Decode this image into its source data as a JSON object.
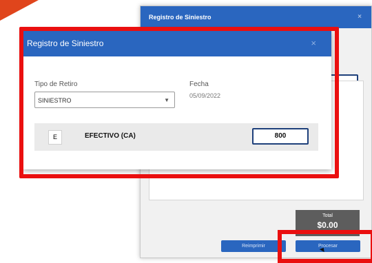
{
  "background_modal": {
    "title": "Registro de Siniestro",
    "close_glyph": "×",
    "total": {
      "label": "Total",
      "value": "$0.00"
    },
    "buttons": {
      "reimprimir": "Reimprimir",
      "procesar": "Procesar"
    }
  },
  "dialog": {
    "title": "Registro de Siniestro",
    "close_glyph": "×",
    "tipo_retiro": {
      "label": "Tipo de Retiro",
      "value": "SINIESTRO",
      "arrow": "▼"
    },
    "fecha": {
      "label": "Fecha",
      "value": "05/09/2022"
    },
    "row": {
      "code": "E",
      "label": "EFECTIVO (CA)",
      "amount": "800"
    }
  },
  "colors": {
    "header_blue": "#2a66bf",
    "highlight_red": "#ea0f0f",
    "total_gray": "#5d5d5d",
    "flag_orange": "#e0451c"
  }
}
